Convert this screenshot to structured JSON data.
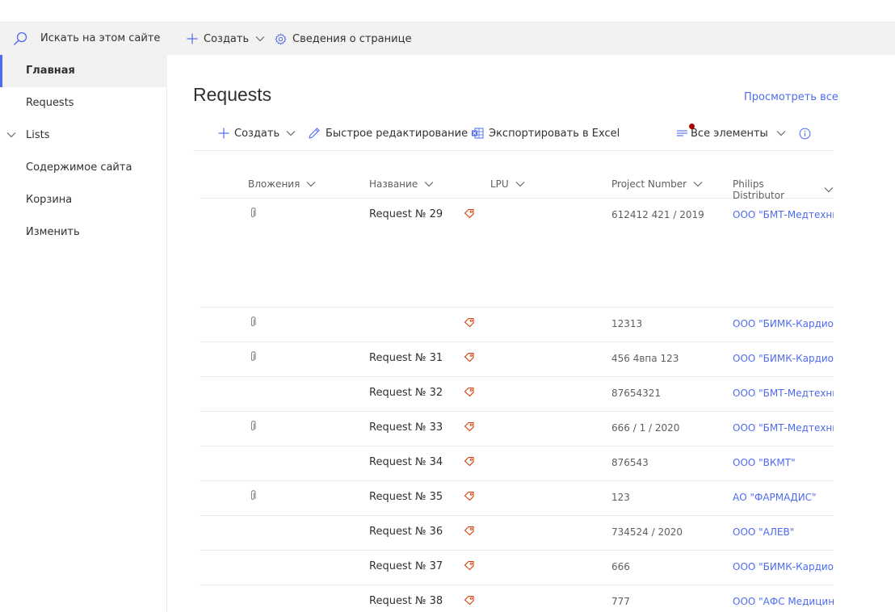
{
  "search": {
    "placeholder": "Искать на этом сайте"
  },
  "nav": {
    "items": [
      {
        "label": "Главная",
        "active": true
      },
      {
        "label": "Requests"
      },
      {
        "label": "Lists",
        "expandable": true
      },
      {
        "label": "Содержимое сайта"
      },
      {
        "label": "Корзина"
      },
      {
        "label": "Изменить"
      }
    ]
  },
  "commandbar": {
    "new_label": "Создать",
    "page_details_label": "Сведения о странице"
  },
  "list": {
    "title": "Requests",
    "view_all": "Просмотреть все",
    "commands": {
      "new_label": "Создать",
      "quick_edit": "Быстрое редактирование",
      "export": "Экспортировать в Excel",
      "view": "Все элементы"
    },
    "columns": [
      "Вложения",
      "Название",
      "LPU",
      "Project Number",
      "Philips Distributor"
    ],
    "rows": [
      {
        "attachment": true,
        "name": "Request № 29",
        "project": "612412 421 / 2019",
        "distributor": "ООО \"БМТ-Медтехника\""
      },
      {
        "attachment": true,
        "name": "",
        "project": "12313",
        "distributor": "ООО \"БИМК-Кардио-Ви\""
      },
      {
        "attachment": true,
        "name": "Request № 31",
        "project": "456 4впа 123",
        "distributor": "ООО \"БИМК-Кардио-Ви\""
      },
      {
        "attachment": false,
        "name": "Request № 32",
        "project": "87654321",
        "distributor": "ООО \"БМТ-Медтехника\""
      },
      {
        "attachment": true,
        "name": "Request № 33",
        "project": "666 / 1 / 2020",
        "distributor": "ООО \"БМТ-Медтехника\""
      },
      {
        "attachment": false,
        "name": "Request № 34",
        "project": "876543",
        "distributor": "ООО \"ВКМТ\""
      },
      {
        "attachment": true,
        "name": "Request № 35",
        "project": "123",
        "distributor": "АО \"ФАРМАДИС\""
      },
      {
        "attachment": false,
        "name": "Request № 36",
        "project": "734524 / 2020",
        "distributor": "ООО \"АЛЕВ\""
      },
      {
        "attachment": false,
        "name": "Request № 37",
        "project": "666",
        "distributor": "ООО \"БИМК-Кардио-Ви\""
      },
      {
        "attachment": false,
        "name": "Request № 38",
        "project": "777",
        "distributor": "ООО \"АФС Медицинтех\""
      }
    ]
  },
  "colors": {
    "accent": "#4f6bed",
    "tag": "#d83b01",
    "status_dot": "#a80000"
  }
}
